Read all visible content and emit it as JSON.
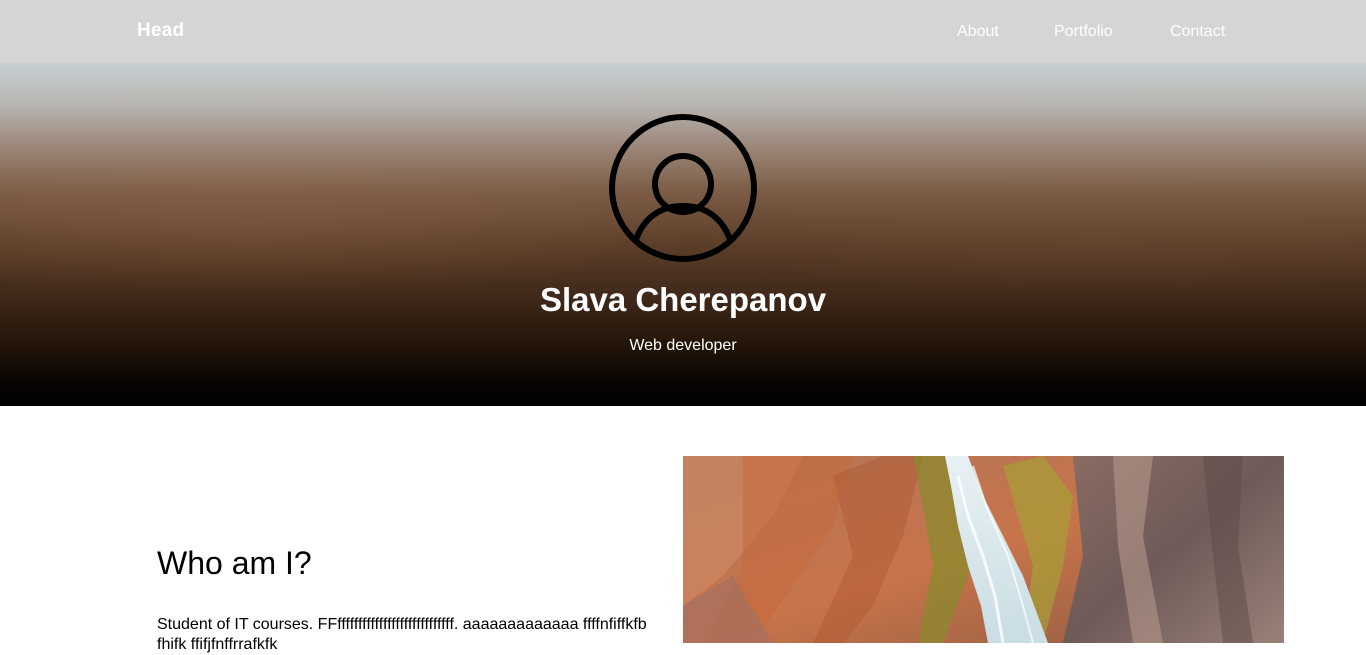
{
  "header": {
    "brand": "Head",
    "nav": [
      {
        "label": "About"
      },
      {
        "label": "Portfolio"
      },
      {
        "label": "Contact"
      }
    ]
  },
  "hero": {
    "avatar_icon": "user-circle-icon",
    "name": "Slava Cherepanov",
    "role": "Web developer"
  },
  "about": {
    "title": "Who am I?",
    "text": "Student of IT courses. FFffffffffffffffffffffffffffff. aaaaaaaaaaaaa ffffnfiffkfbfhifk ffifjfnffrrafkfk",
    "image": "waterfall-photo"
  },
  "colors": {
    "nav_bg": "#d5d5d5",
    "hero_top": "#c6cfd2",
    "hero_bottom": "#000000",
    "text_light": "#ffffff"
  }
}
